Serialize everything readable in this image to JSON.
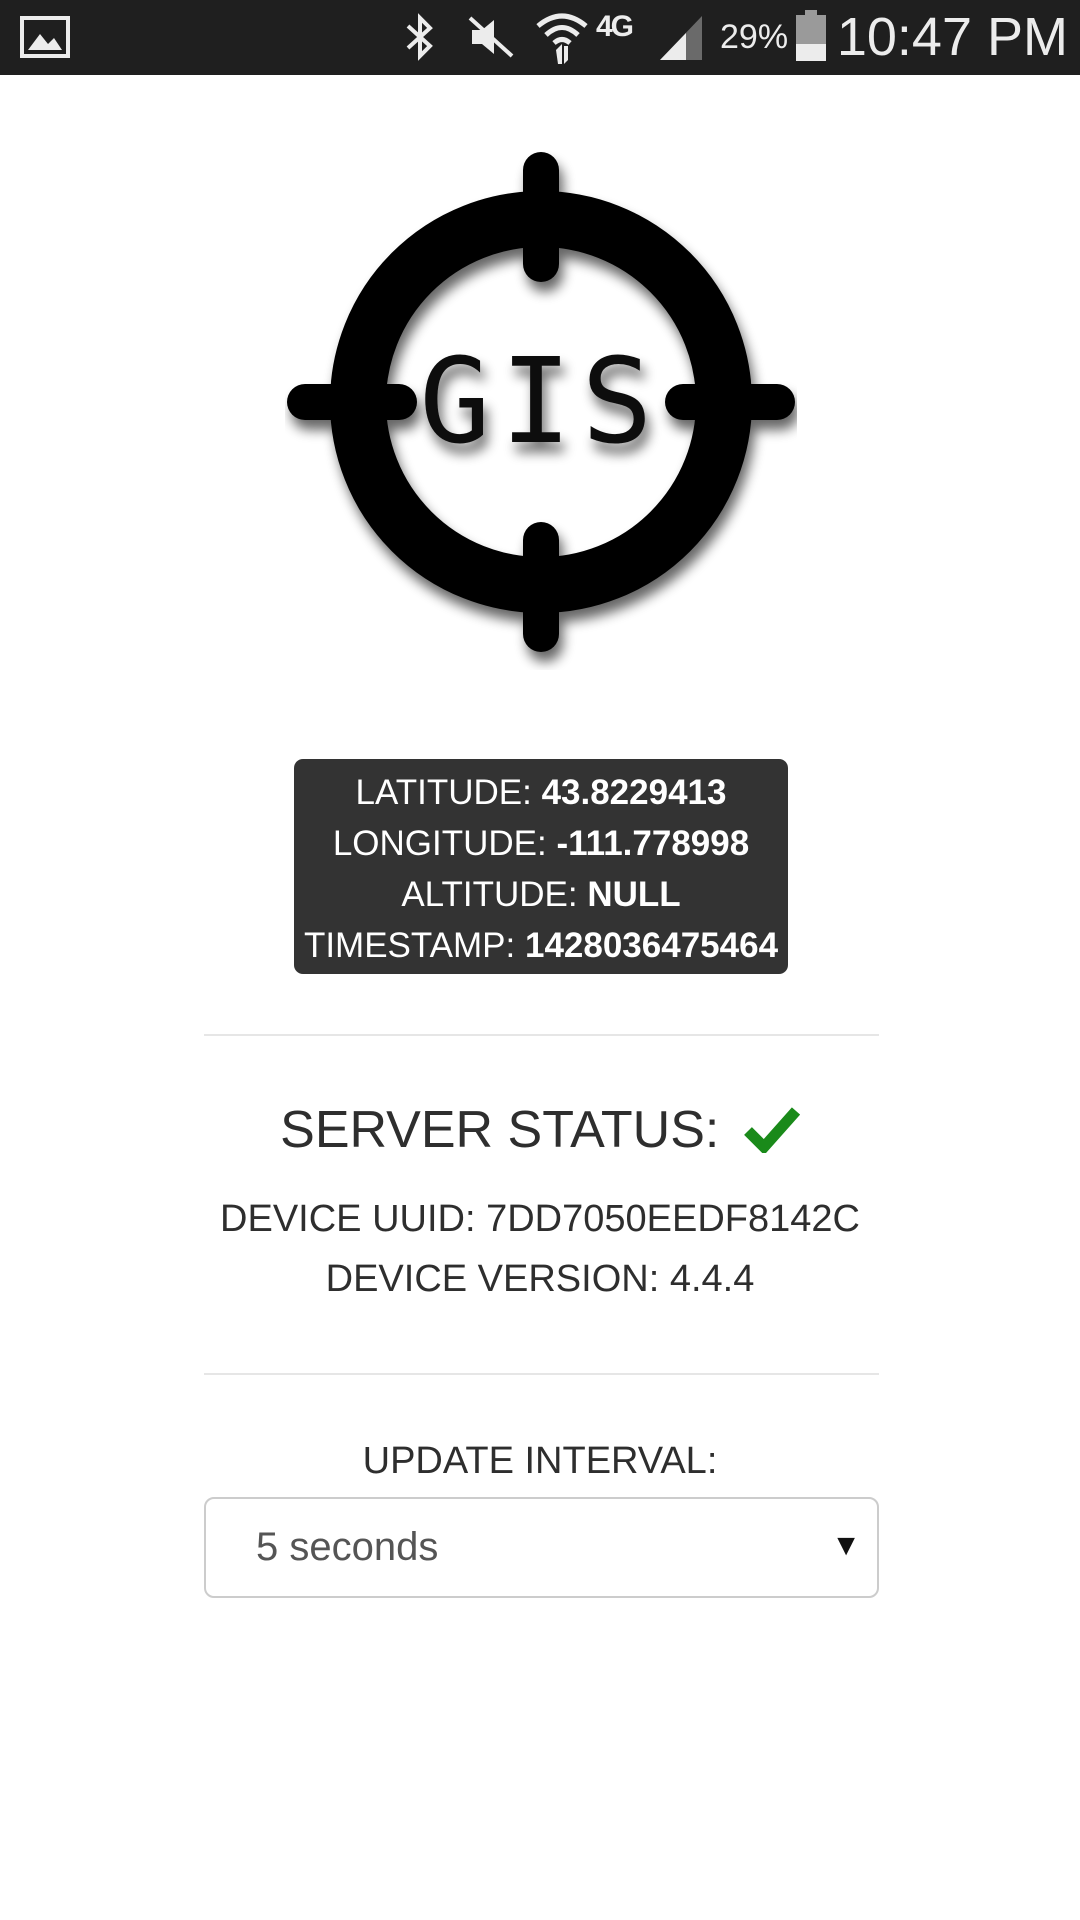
{
  "status_bar": {
    "battery_percent": "29%",
    "time": "10:47 PM",
    "network_label": "4G",
    "icons": [
      "gallery-icon",
      "bluetooth-icon",
      "vibrate-mute-icon",
      "wifi-icon",
      "4g-lte-icon",
      "signal-icon",
      "battery-icon"
    ]
  },
  "logo": {
    "text": "GIS"
  },
  "coords": {
    "latitude_label": "LATITUDE:",
    "latitude_value": "43.8229413",
    "longitude_label": "LONGITUDE:",
    "longitude_value": "-111.778998",
    "altitude_label": "ALTITUDE:",
    "altitude_value": "NULL",
    "timestamp_label": "TIMESTAMP:",
    "timestamp_value": "1428036475464"
  },
  "server": {
    "status_label": "SERVER STATUS:",
    "status_icon": "check-icon",
    "status_color": "#1a8a1a"
  },
  "device": {
    "uuid_line": "DEVICE UUID: 7DD7050EEDF8142C",
    "version_line": "DEVICE VERSION: 4.4.4"
  },
  "update_interval": {
    "label": "UPDATE INTERVAL:",
    "selected": "5 seconds"
  }
}
